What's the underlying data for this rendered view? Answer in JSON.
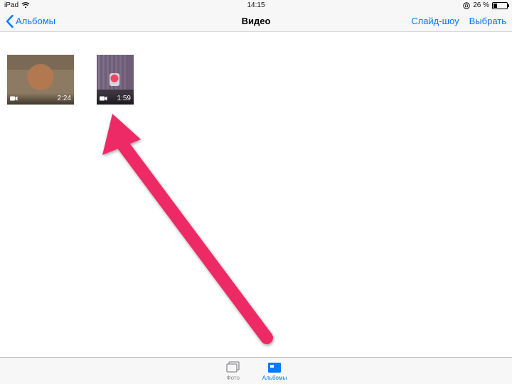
{
  "status": {
    "device": "iPad",
    "time": "14:15",
    "battery_text": "26 %",
    "battery_level": 26
  },
  "nav": {
    "back_label": "Альбомы",
    "title": "Видео",
    "slideshow_label": "Слайд-шоу",
    "select_label": "Выбрать"
  },
  "videos": [
    {
      "duration": "2:24"
    },
    {
      "duration": "1:59"
    }
  ],
  "tabs": {
    "photo": "Фото",
    "albums": "Альбомы"
  }
}
